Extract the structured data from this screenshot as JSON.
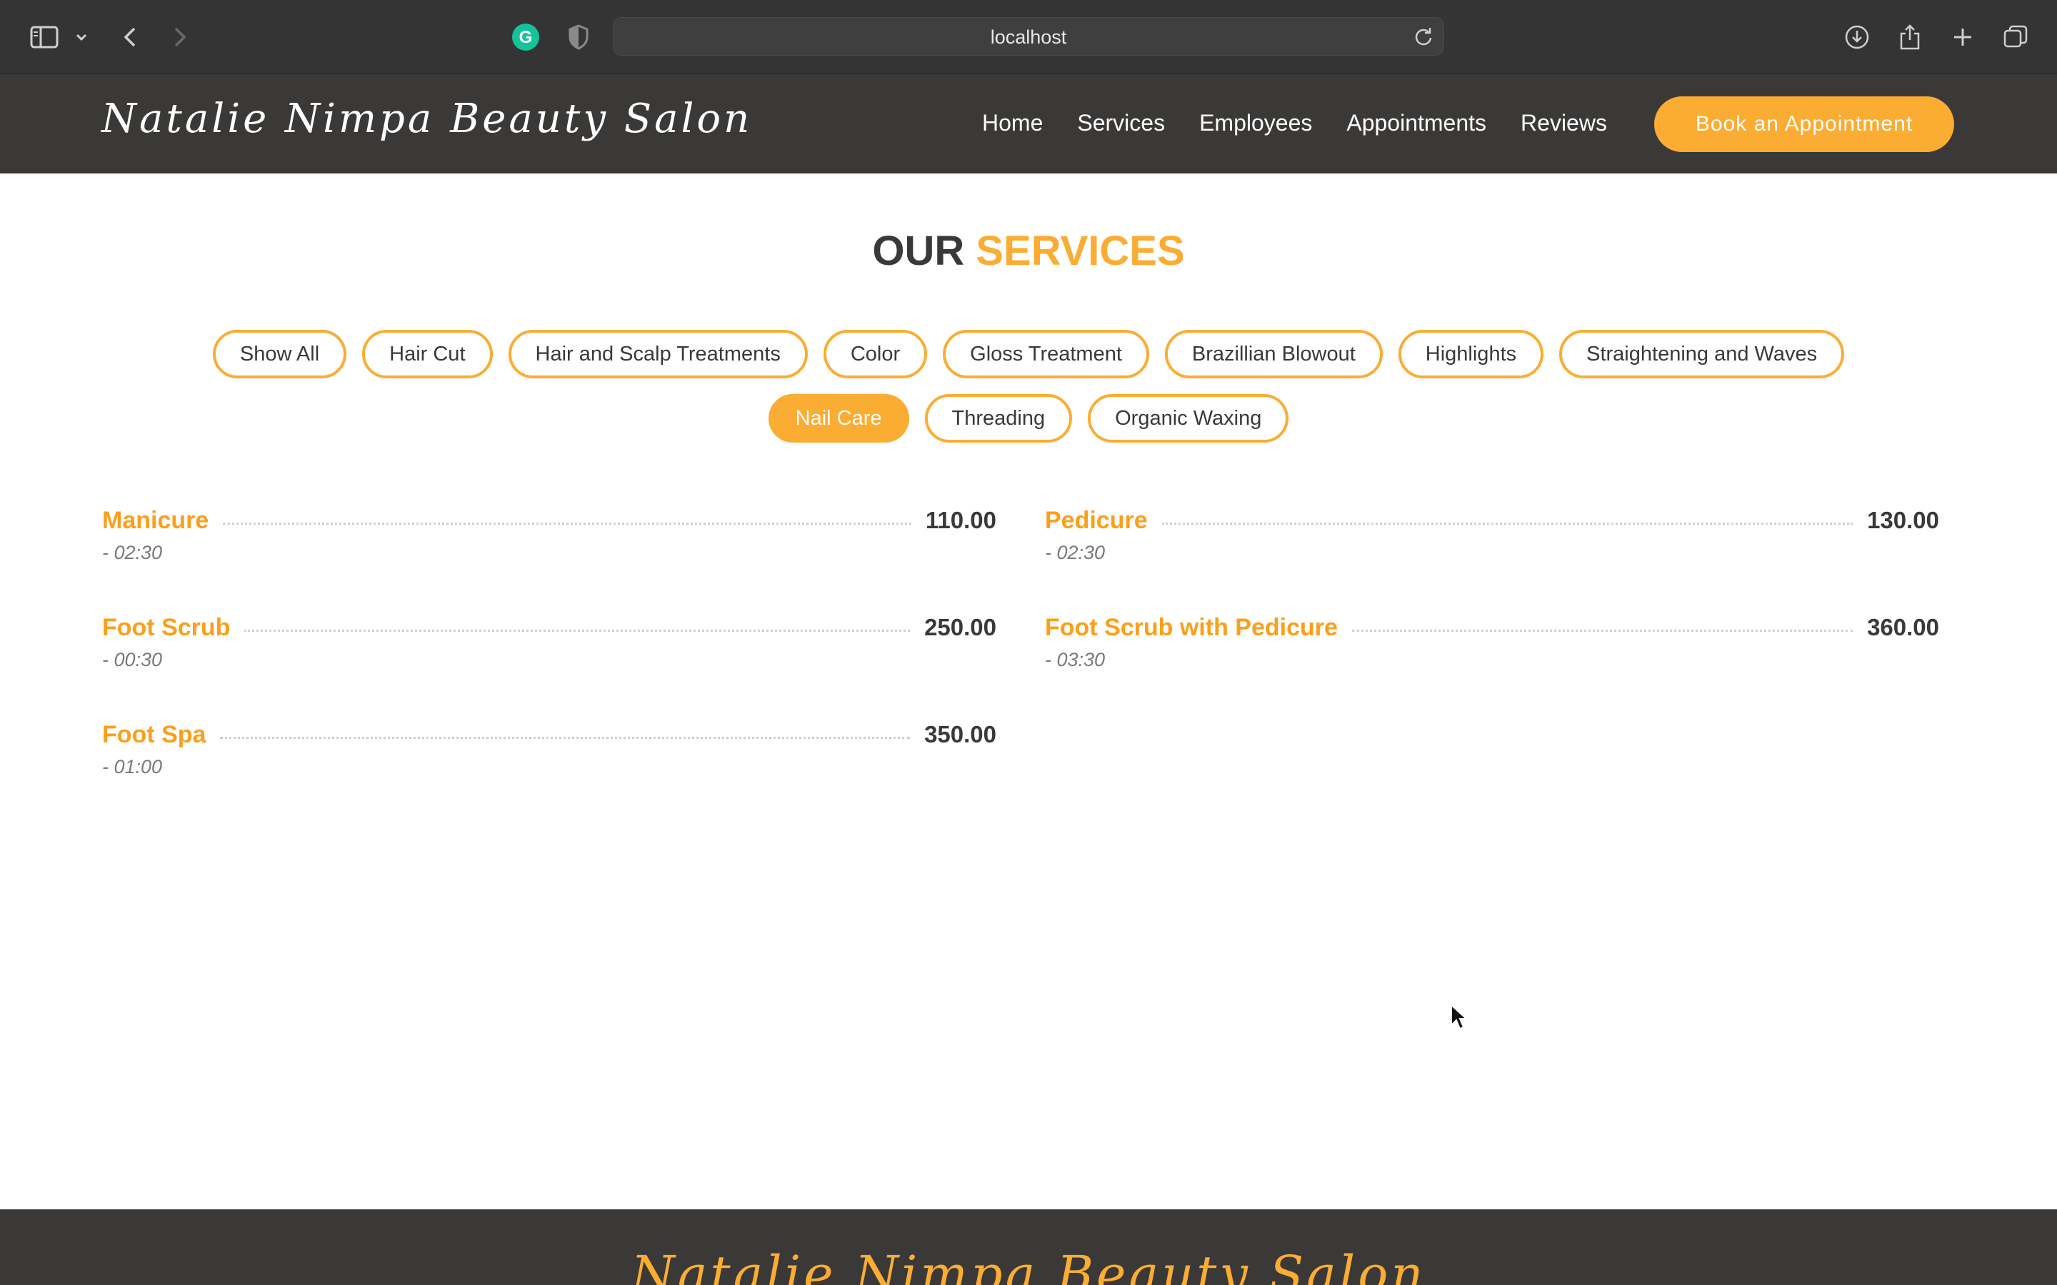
{
  "browser": {
    "url": "localhost",
    "icons": [
      "sidebar-icon",
      "chevron-down-icon",
      "back-arrow-icon",
      "forward-arrow-icon",
      "grammarly-icon",
      "shield-icon",
      "reload-icon",
      "download-icon",
      "share-icon",
      "new-tab-icon",
      "tabs-overview-icon"
    ]
  },
  "header": {
    "logo": "Natalie Nimpa Beauty Salon",
    "nav": [
      "Home",
      "Services",
      "Employees",
      "Appointments",
      "Reviews"
    ],
    "cta": "Book an Appointment"
  },
  "main": {
    "title_part1": "OUR",
    "title_part2": "SERVICES",
    "filters_row1": [
      "Show All",
      "Hair Cut",
      "Hair and Scalp Treatments",
      "Color",
      "Gloss Treatment",
      "Brazillian Blowout",
      "Highlights",
      "Straightening and Waves"
    ],
    "filters_row2": [
      "Nail Care",
      "Threading",
      "Organic Waxing"
    ],
    "active_filter": "Nail Care",
    "services": [
      {
        "name": "Manicure",
        "price": "110.00",
        "duration": "- 02:30"
      },
      {
        "name": "Pedicure",
        "price": "130.00",
        "duration": "- 02:30"
      },
      {
        "name": "Foot Scrub",
        "price": "250.00",
        "duration": "- 00:30"
      },
      {
        "name": "Foot Scrub with Pedicure",
        "price": "360.00",
        "duration": "- 03:30"
      },
      {
        "name": "Foot Spa",
        "price": "350.00",
        "duration": "- 01:00"
      }
    ]
  },
  "footer": {
    "logo": "Natalie Nimpa Beauty Salon"
  },
  "colors": {
    "accent": "#fbac33",
    "dark": "#3a3937",
    "service_name": "#fb9f1b"
  }
}
